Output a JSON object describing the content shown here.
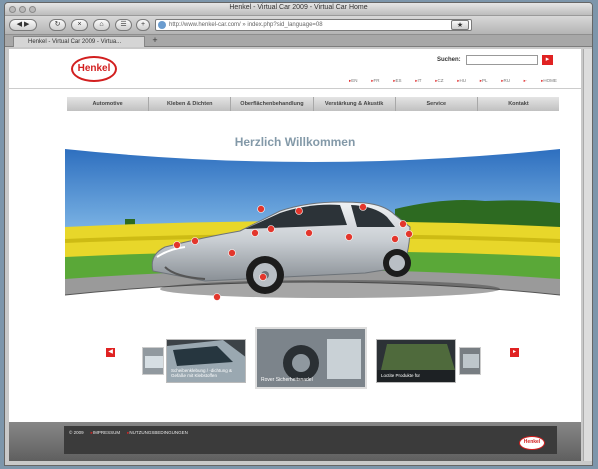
{
  "browser": {
    "window_title": "Henkel - Virtual Car 2009 - Virtual Car Home",
    "url": "http://www.henkel-car.com/ » index.php?sid_language=08",
    "tab_label": "Henkel - Virtual Car 2009 - Virtua...",
    "add_tab": "+"
  },
  "header": {
    "logo_text": "Henkel",
    "search_label": "Suchen:",
    "search_value": "",
    "search_go": "▸",
    "languages": [
      "EN",
      "FR",
      "ES",
      "IT",
      "CZ",
      "HU",
      "PL",
      "RU",
      "·",
      "HOME"
    ]
  },
  "nav": {
    "items": [
      "Automotive",
      "Kleben & Dichten",
      "Oberflächenbehandlung",
      "Verstärkung & Akustik",
      "Service",
      "Kontakt"
    ]
  },
  "main": {
    "welcome": "Herzlich Willkommen"
  },
  "gallery": {
    "prev": "◀",
    "next": "▸",
    "items": [
      {
        "caption": "Scheibenklebung / -dichtung & Gefaße mit Klebstoffen"
      },
      {
        "caption": "Rover Sicherheitsnadel"
      },
      {
        "caption": "Loctite Produkte für"
      }
    ]
  },
  "footer": {
    "links": [
      "© 2009",
      "IMPRESSUM",
      "NUTZUNGSBEDINGUNGEN"
    ],
    "logo_text": "Henkel"
  },
  "colors": {
    "brand_red": "#e02222",
    "sky": "#4f8fd0",
    "field": "#e8d72a"
  }
}
